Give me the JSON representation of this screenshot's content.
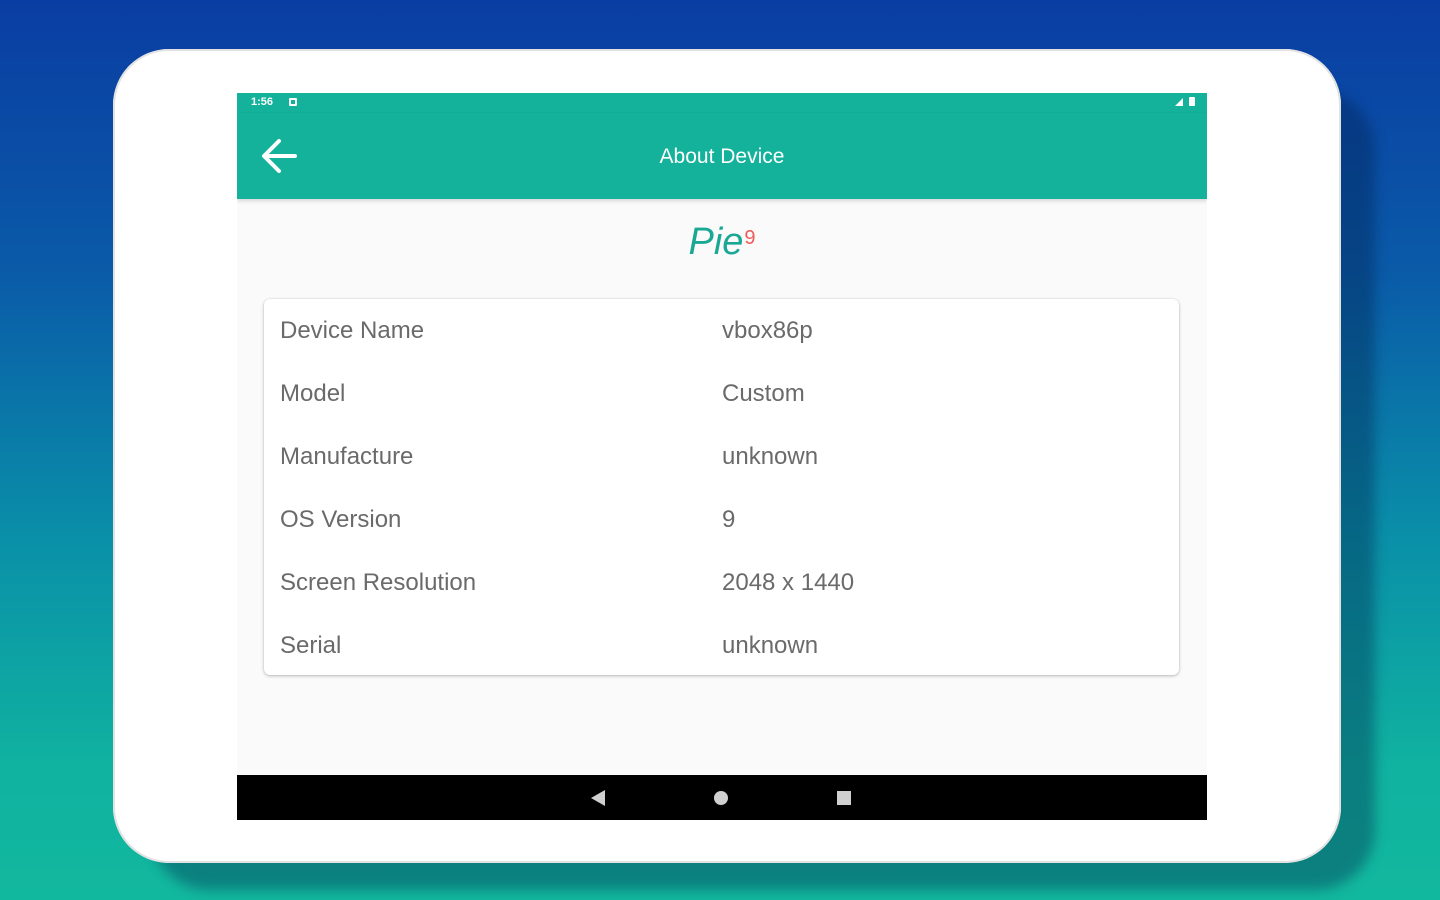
{
  "status_bar": {
    "time": "1:56",
    "notification_icon": "notification-square-icon",
    "signal_icon": "signal-icon",
    "battery_icon": "battery-icon"
  },
  "app_bar": {
    "title": "About Device",
    "back_icon": "arrow-left-icon",
    "background_color": "#14b29b"
  },
  "os_badge": {
    "name": "Pie",
    "version_superscript": "9",
    "name_color": "#1aa895",
    "superscript_color": "#f25a5a"
  },
  "device_info": {
    "rows": [
      {
        "label": "Device Name",
        "value": "vbox86p"
      },
      {
        "label": "Model",
        "value": "Custom"
      },
      {
        "label": "Manufacture",
        "value": "unknown"
      },
      {
        "label": "OS Version",
        "value": "9"
      },
      {
        "label": "Screen Resolution",
        "value": "2048 x 1440"
      },
      {
        "label": "Serial",
        "value": "unknown"
      }
    ]
  },
  "nav_bar": {
    "back_icon": "nav-back-triangle-icon",
    "home_icon": "nav-home-circle-icon",
    "recents_icon": "nav-recents-square-icon"
  }
}
